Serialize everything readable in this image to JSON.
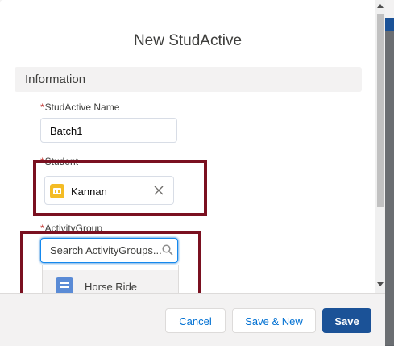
{
  "modal": {
    "title": "New StudActive"
  },
  "section": {
    "header": "Information"
  },
  "fields": {
    "name": {
      "required_mark": "*",
      "label": "StudActive Name",
      "value": "Batch1"
    },
    "student": {
      "required_mark": "*",
      "label": "Student",
      "selected": "Kannan",
      "clear_icon": "close-icon"
    },
    "activity_group": {
      "required_mark": "*",
      "label": "ActivityGroup",
      "placeholder": "Search ActivityGroups...",
      "search_icon": "search-icon",
      "options": [
        {
          "label": "Horse Ride",
          "icon": "record-icon"
        }
      ]
    }
  },
  "footer": {
    "cancel_label": "Cancel",
    "save_new_label": "Save & New",
    "save_label": "Save"
  },
  "colors": {
    "brand": "#1b5297",
    "highlight_box": "#7a1020",
    "focus_border": "#1589ee",
    "required": "#c23934",
    "student_icon": "#f4bc25",
    "option_icon": "#5a8bd6"
  }
}
